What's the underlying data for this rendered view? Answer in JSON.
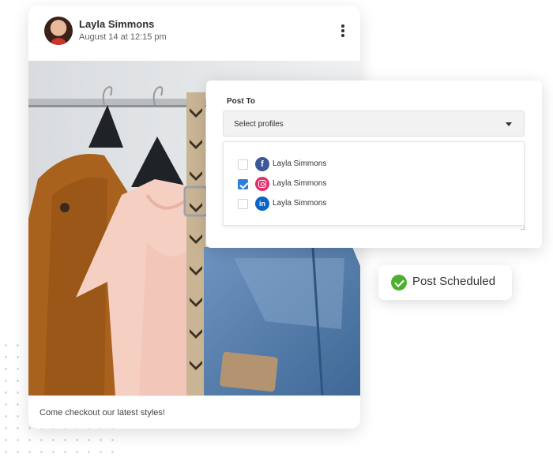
{
  "post": {
    "author": "Layla Simmons",
    "timestamp": "August 14 at 12:15 pm",
    "caption": "Come checkout our latest styles!"
  },
  "post_to": {
    "label": "Post To",
    "select_placeholder": "Select profiles",
    "profiles": [
      {
        "network": "facebook",
        "icon": "facebook-icon",
        "icon_glyph": "f",
        "name": "Layla Simmons",
        "checked": false
      },
      {
        "network": "instagram",
        "icon": "instagram-icon",
        "icon_glyph": "",
        "name": "Layla Simmons",
        "checked": true
      },
      {
        "network": "linkedin",
        "icon": "linkedin-icon",
        "icon_glyph": "in",
        "name": "Layla Simmons",
        "checked": false
      }
    ]
  },
  "toast": {
    "text": "Post Scheduled",
    "icon": "check-circle-icon"
  },
  "colors": {
    "checkbox_accent": "#2f7fd9",
    "success": "#4caf2e",
    "facebook": "#3b5998",
    "instagram": "#e1306c",
    "linkedin": "#0a66c2"
  }
}
